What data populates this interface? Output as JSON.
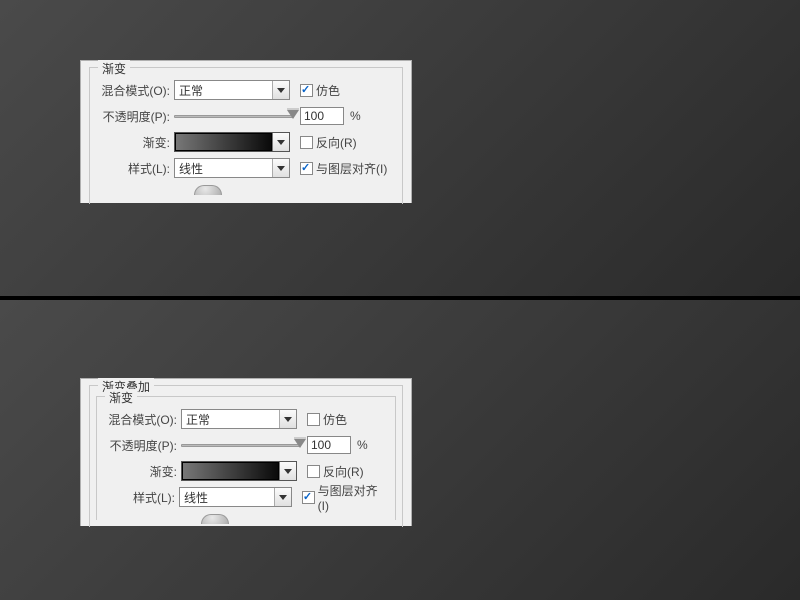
{
  "panel1": {
    "legend": "渐变",
    "blend": {
      "label": "混合模式(O):",
      "value": "正常"
    },
    "dither": {
      "label": "仿色",
      "checked": true
    },
    "opacity": {
      "label": "不透明度(P):",
      "value": "100",
      "unit": "%"
    },
    "gradient": {
      "label": "渐变:"
    },
    "reverse": {
      "label": "反向(R)",
      "checked": false
    },
    "style": {
      "label": "样式(L):",
      "value": "线性"
    },
    "align": {
      "label": "与图层对齐(I)",
      "checked": true
    }
  },
  "panel2": {
    "outer_legend": "渐变叠加",
    "inner_legend": "渐变",
    "blend": {
      "label": "混合模式(O):",
      "value": "正常"
    },
    "dither": {
      "label": "仿色",
      "checked": false
    },
    "opacity": {
      "label": "不透明度(P):",
      "value": "100",
      "unit": "%"
    },
    "gradient": {
      "label": "渐变:"
    },
    "reverse": {
      "label": "反向(R)",
      "checked": false
    },
    "style": {
      "label": "样式(L):",
      "value": "线性"
    },
    "align": {
      "label": "与图层对齐(I)",
      "checked": true
    }
  }
}
